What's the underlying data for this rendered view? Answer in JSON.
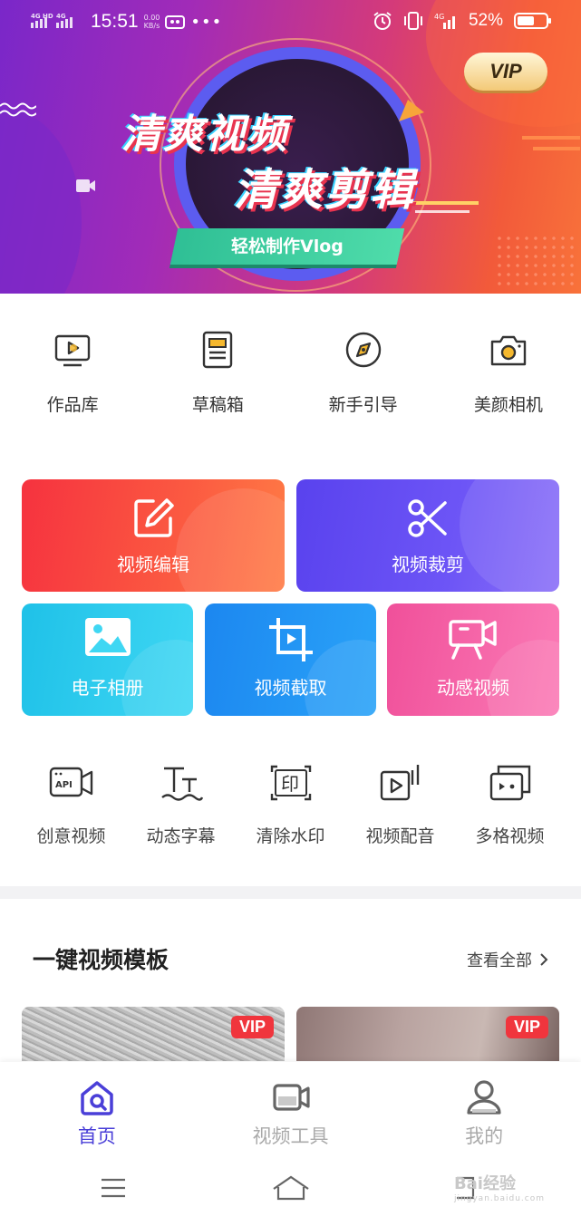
{
  "status_bar": {
    "network_left": "4G HD",
    "network_right": "4G",
    "time": "15:51",
    "speed_value": "0.00",
    "speed_unit": "KB/s",
    "battery": "52%"
  },
  "banner": {
    "headline_line1": "清爽视频",
    "headline_line2": "清爽剪辑",
    "ribbon": "轻松制作Vlog",
    "vip_label": "VIP"
  },
  "quick_actions": [
    {
      "label": "作品库",
      "icon": "play-screen-icon"
    },
    {
      "label": "草稿箱",
      "icon": "draft-icon"
    },
    {
      "label": "新手引导",
      "icon": "compass-icon"
    },
    {
      "label": "美颜相机",
      "icon": "camera-icon"
    }
  ],
  "features": {
    "edit": {
      "label": "视频编辑",
      "icon": "edit-icon"
    },
    "crop": {
      "label": "视频裁剪",
      "icon": "scissors-icon"
    },
    "album": {
      "label": "电子相册",
      "icon": "image-icon"
    },
    "capture": {
      "label": "视频截取",
      "icon": "crop-frame-icon"
    },
    "dynamic": {
      "label": "动感视频",
      "icon": "video-camera-icon"
    }
  },
  "tools": [
    {
      "label": "创意视频",
      "icon": "api-camera-icon",
      "icon_text": "API"
    },
    {
      "label": "动态字幕",
      "icon": "subtitle-icon"
    },
    {
      "label": "清除水印",
      "icon": "watermark-icon",
      "icon_text": "印"
    },
    {
      "label": "视频配音",
      "icon": "dubbing-icon"
    },
    {
      "label": "多格视频",
      "icon": "multi-grid-icon"
    }
  ],
  "templates": {
    "title": "一键视频模板",
    "view_all": "查看全部",
    "items": [
      {
        "tag": "VIP"
      },
      {
        "tag": "VIP"
      }
    ]
  },
  "bottom_nav": [
    {
      "label": "首页",
      "active": true
    },
    {
      "label": "视频工具",
      "active": false
    },
    {
      "label": "我的",
      "active": false
    }
  ],
  "watermark": {
    "text": "Bai经验",
    "sub": "jingyan.baidu.com"
  },
  "colors": {
    "accent": "#4a3fd8",
    "vip_red": "#f0353d",
    "card_edit": "#f6323f",
    "card_crop": "#5942ee",
    "card_album": "#1fc1e8",
    "card_capture": "#1c87f0",
    "card_dynamic": "#f0509a"
  }
}
